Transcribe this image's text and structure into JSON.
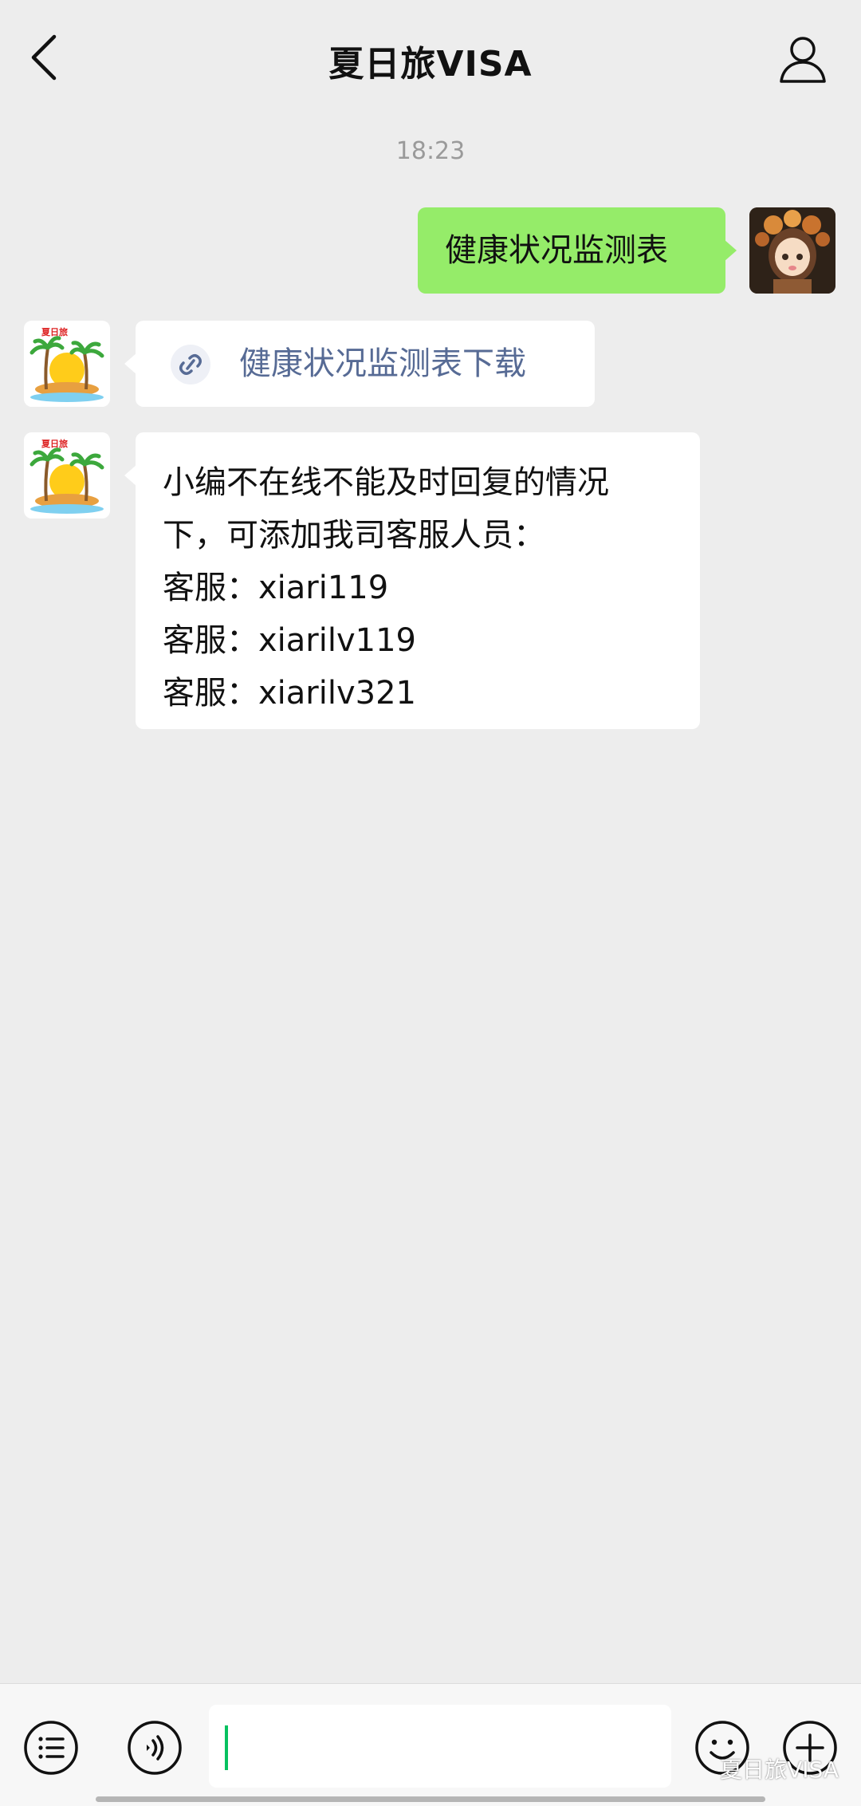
{
  "header": {
    "title": "夏日旅VISA",
    "back_icon": "chevron-left-icon",
    "profile_icon": "person-icon"
  },
  "chat": {
    "timestamp": "18:23",
    "outgoing_message": "健康状况监测表",
    "link_message": {
      "icon": "link-icon",
      "label": "健康状况监测表下载"
    },
    "incoming_message_lines": [
      "小编不在线不能及时回复的情况",
      "下，可添加我司客服人员：",
      "客服：xiari119",
      "客服：xiarilv119",
      "客服：xiarilv321"
    ],
    "bot_avatar_text": "夏日旅"
  },
  "input_bar": {
    "menu_icon": "list-icon",
    "voice_icon": "voice-icon",
    "emoji_icon": "emoji-icon",
    "plus_icon": "plus-icon",
    "watermark": "夏日旅VISA"
  },
  "colors": {
    "background": "#ededed",
    "outgoing_bubble": "#95ec69",
    "incoming_bubble": "#ffffff",
    "link_text": "#576b95",
    "timestamp": "#9a9a9a",
    "caret": "#07c160"
  }
}
